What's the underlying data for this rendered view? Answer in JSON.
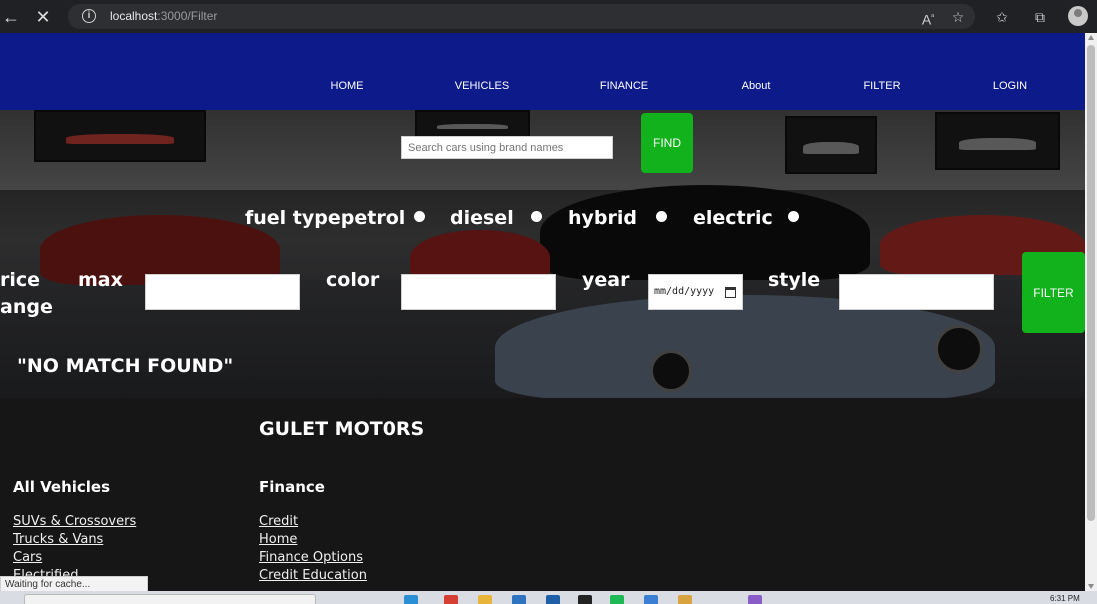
{
  "browser": {
    "url_host": "localhost",
    "url_path": ":3000/Filter",
    "back_glyph": "←",
    "stop_glyph": "✕",
    "info_glyph": "i"
  },
  "nav": {
    "items": [
      {
        "label": "HOME"
      },
      {
        "label": "VEHICLES"
      },
      {
        "label": "FINANCE"
      },
      {
        "label": "About"
      },
      {
        "label": "FILTER"
      },
      {
        "label": "LOGIN"
      }
    ]
  },
  "search": {
    "placeholder": "Search cars using brand names",
    "button_label": "FIND"
  },
  "fuel": {
    "label": "fuel type",
    "options": [
      "petrol",
      "diesel",
      "hybrid",
      "electric"
    ]
  },
  "filters": {
    "price_label_1": "rice",
    "price_label_2": "ange",
    "max_label": "max",
    "color_label": "color",
    "year_label": "year",
    "year_placeholder": "mm/dd/yyyy",
    "style_label": "style",
    "button_label": "FILTER"
  },
  "result": {
    "message": "\"NO MATCH FOUND\""
  },
  "footer": {
    "brand": "GULET MOT0RS",
    "vehicles": {
      "title": "All Vehicles",
      "links": [
        "SUVs & Crossovers",
        "Trucks & Vans",
        "Cars",
        "Electrified"
      ]
    },
    "finance": {
      "title": "Finance",
      "links": [
        "Credit",
        "Home",
        "Finance Options",
        "Credit Education"
      ]
    }
  },
  "status": {
    "text": "Waiting for cache..."
  },
  "taskbar": {
    "clock": "6:31 PM"
  },
  "colors": {
    "nav_bg": "#0d1a8a",
    "button_green": "#12b21d",
    "footer_bg": "#161616"
  }
}
